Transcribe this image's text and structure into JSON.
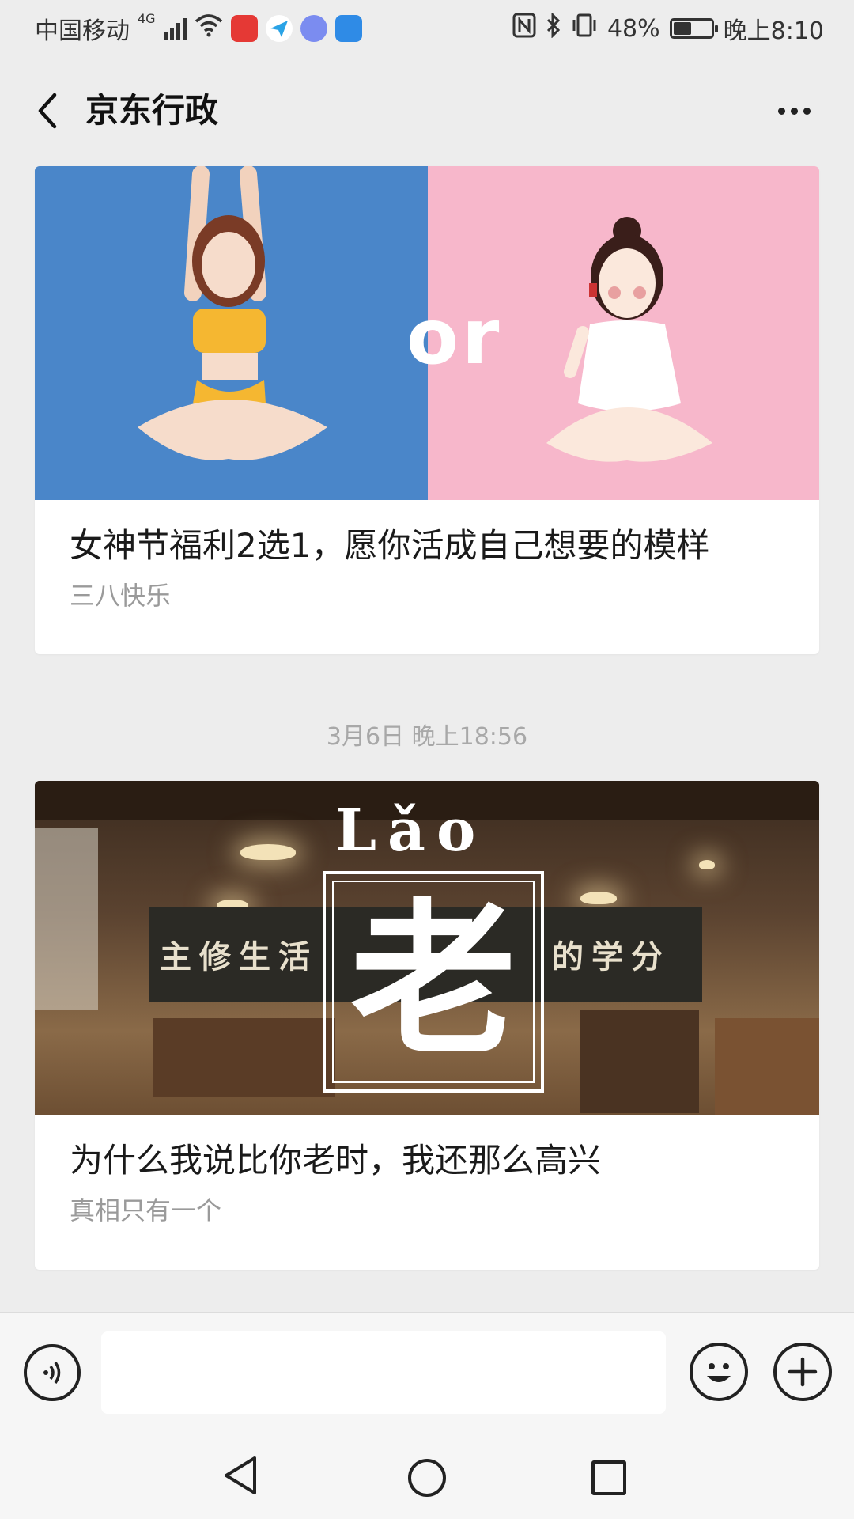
{
  "status_bar": {
    "carrier": "中国移动",
    "network": "4G",
    "battery_percent": "48%",
    "battery_level": 0.48,
    "time": "晚上8:10",
    "icons": [
      "signal-icon",
      "wifi-icon",
      "huawei-app-icon",
      "paper-plane-app-icon",
      "music-app-icon",
      "shield-app-icon",
      "nfc-icon",
      "bluetooth-icon",
      "vibrate-icon",
      "battery-charging-icon"
    ]
  },
  "header": {
    "title": "京东行政"
  },
  "messages": [
    {
      "title": "女神节福利2选1，愿你活成自己想要的模样",
      "subtitle": "三八快乐",
      "image": {
        "overlay_text": "or",
        "left_color": "#4a86c9",
        "right_color": "#f7b7cb"
      }
    },
    {
      "title": "为什么我说比你老时，我还那么高兴",
      "subtitle": "真相只有一个",
      "image": {
        "pinyin": "Lǎo",
        "character": "老",
        "chalk_left": "主修生活",
        "chalk_right": "的学分"
      }
    }
  ],
  "timestamp": "3月6日 晚上18:56",
  "input_bar": {
    "placeholder": "",
    "value": ""
  }
}
